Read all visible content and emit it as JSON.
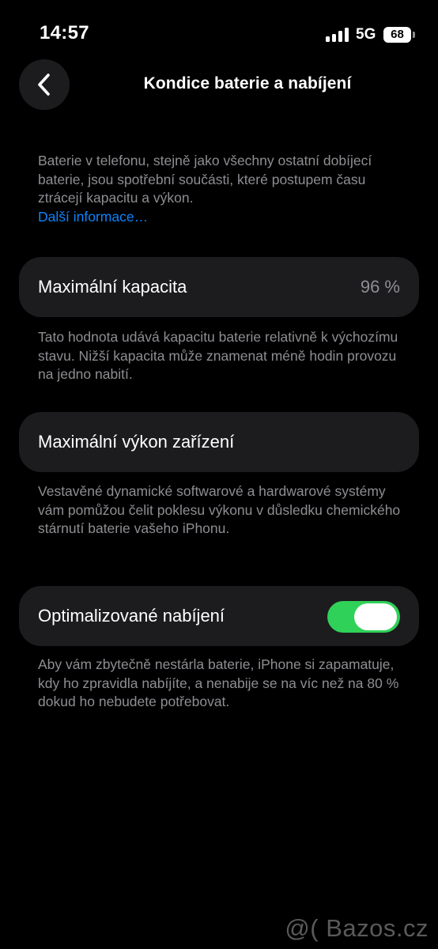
{
  "status_bar": {
    "time": "14:57",
    "network": "5G",
    "battery_level": "68",
    "signal_bars": 4
  },
  "header": {
    "back_icon": "chevron-left-icon",
    "title": "Kondice baterie a nabíjení"
  },
  "intro": {
    "text": "Baterie v telefonu, stejně jako všechny ostatní dobíjecí baterie, jsou spotřební součásti, které postupem času ztrácejí kapacitu a výkon.",
    "link": "Další informace…"
  },
  "max_capacity": {
    "label": "Maximální kapacita",
    "value": "96 %",
    "description": "Tato hodnota udává kapacitu baterie relativně k výchozímu stavu. Nižší kapacita může znamenat méně hodin provozu na jedno nabití."
  },
  "peak_performance": {
    "label": "Maximální výkon zařízení",
    "description": "Vestavěné dynamické softwarové a hardwarové systémy vám pomůžou čelit poklesu výkonu v důsledku chemického stárnutí baterie vašeho iPhonu."
  },
  "optimized_charging": {
    "label": "Optimalizované nabíjení",
    "enabled": true,
    "description": "Aby vám zbytečně nestárla baterie, iPhone si zapamatuje, kdy ho zpravidla nabíjíte, a nenabije se na víc než na 80 % dokud ho nebudete potřebovat."
  },
  "colors": {
    "accent": "#0a84ff",
    "toggle_on": "#30d158",
    "cell_bg": "#1c1c1e",
    "secondary_text": "#8e8e93"
  },
  "watermark": "@( Bazos.cz"
}
